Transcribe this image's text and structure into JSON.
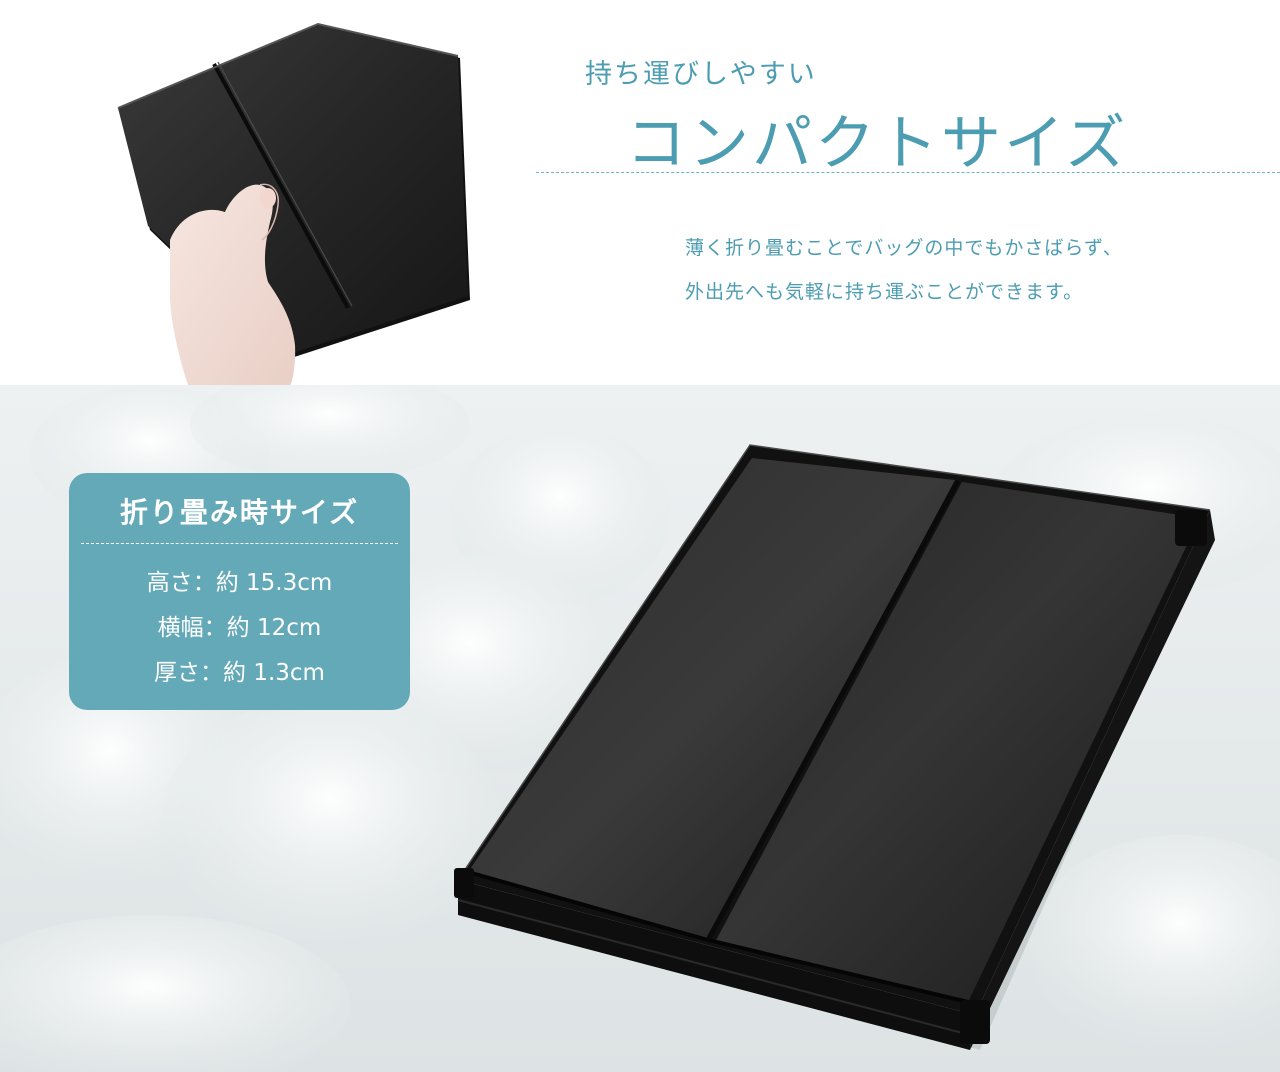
{
  "header": {
    "subtitle": "持ち運びしやすい",
    "title": "コンパクトサイズ",
    "description": [
      "薄く折り畳むことでバッグの中でもかさばらず、",
      "外出先へも気軽に持ち運ぶことができます。"
    ]
  },
  "spec_card": {
    "title": "折り畳み時サイズ",
    "rows": [
      "高さ：約 15.3cm",
      "横幅：約 12cm",
      "厚さ：約 1.3cm"
    ]
  },
  "colors": {
    "accent": "#4d9db2",
    "card_bg": "#64a9b8",
    "product": "#1f1f1f"
  }
}
